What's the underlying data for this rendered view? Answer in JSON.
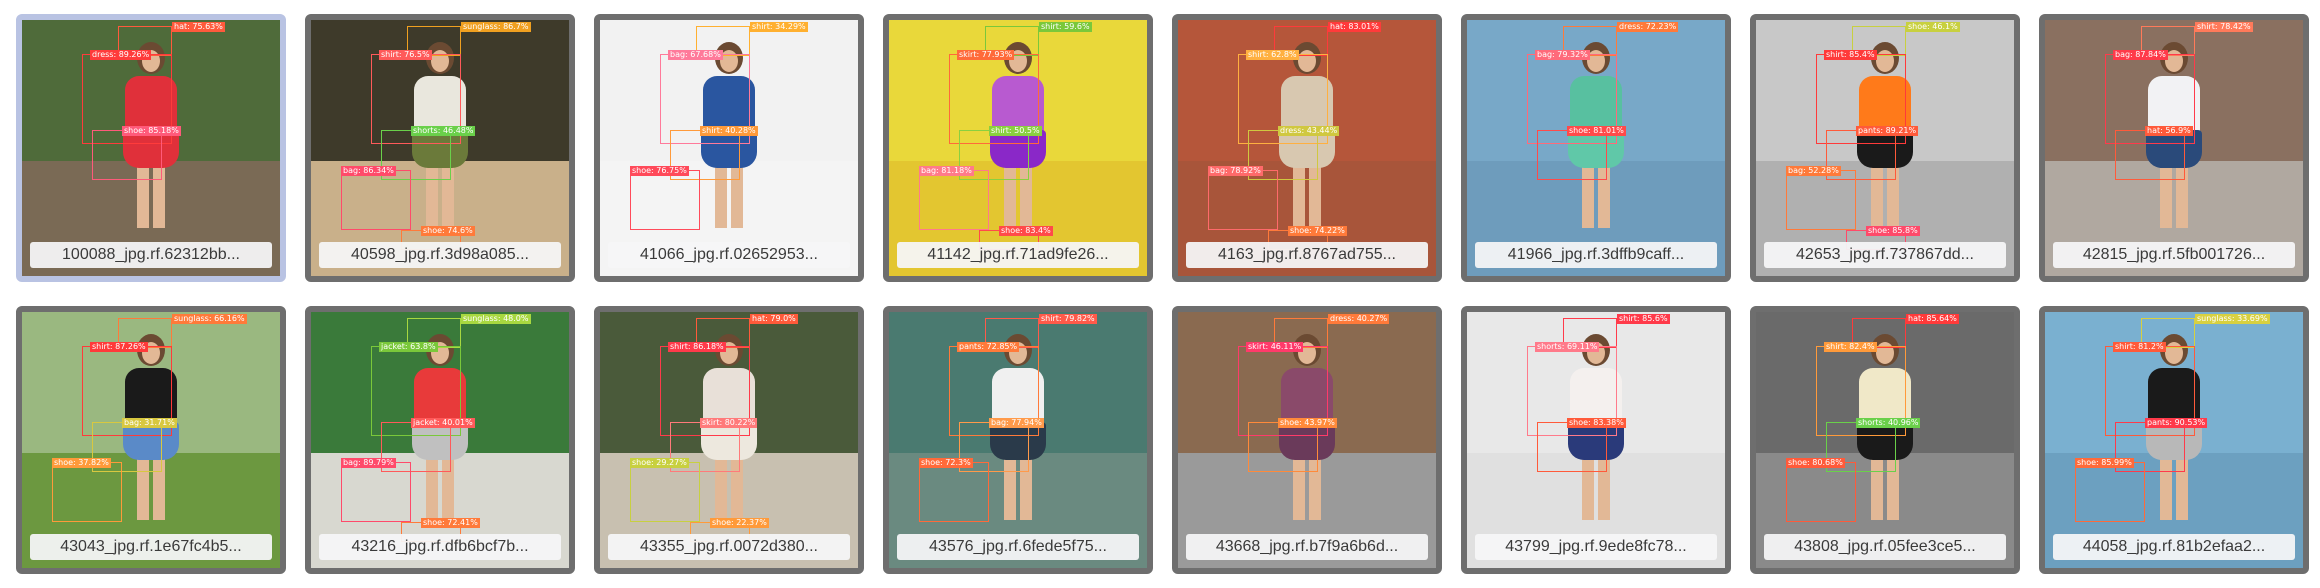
{
  "gallery": {
    "items": [
      {
        "filename": "100088_jpg.rf.62312bb...",
        "selected": true,
        "bg": [
          "#4f6b3a",
          "#7a6a55"
        ],
        "top": "#e0303a",
        "bottom": "#e0303a",
        "labels": [
          {
            "text": "hat: 75.63%",
            "color": "#ff5a3c"
          },
          {
            "text": "dress: 89.26%",
            "color": "#ff3b3b"
          },
          {
            "text": "shoe: 85.18%",
            "color": "#ff5a7a"
          }
        ]
      },
      {
        "filename": "40598_jpg.rf.3d98a085...",
        "selected": false,
        "bg": [
          "#3e3a2a",
          "#c9b08a"
        ],
        "top": "#e9e7dd",
        "bottom": "#6b7a3a",
        "labels": [
          {
            "text": "sunglass: 86.7%",
            "color": "#f0a020"
          },
          {
            "text": "shirt: 76.5%",
            "color": "#ff5a5a"
          },
          {
            "text": "shorts: 46.48%",
            "color": "#6ad04a"
          },
          {
            "text": "bag: 86.34%",
            "color": "#ff4a6a"
          },
          {
            "text": "shoe: 74.6%",
            "color": "#ff7a3a"
          }
        ]
      },
      {
        "filename": "41066_jpg.rf.02652953...",
        "selected": false,
        "bg": [
          "#f2f2f2",
          "#f4f4f4"
        ],
        "top": "#2a56a0",
        "bottom": "#2a56a0",
        "labels": [
          {
            "text": "shirt: 34.29%",
            "color": "#ffb030"
          },
          {
            "text": "bag: 67.68%",
            "color": "#ff7a9a"
          },
          {
            "text": "shirt: 40.28%",
            "color": "#ff9a3a"
          },
          {
            "text": "shoe: 76.75%",
            "color": "#ff4a5a"
          }
        ]
      },
      {
        "filename": "41142_jpg.rf.71ad9fe26...",
        "selected": false,
        "bg": [
          "#e9d83a",
          "#e3c630"
        ],
        "top": "#b85ad0",
        "bottom": "#8a28c8",
        "labels": [
          {
            "text": "shirt: 59.6%",
            "color": "#7ac83a"
          },
          {
            "text": "skirt: 77.93%",
            "color": "#ff6a3a"
          },
          {
            "text": "shirt: 50.5%",
            "color": "#8ad040"
          },
          {
            "text": "bag: 81.18%",
            "color": "#ff7a8a"
          },
          {
            "text": "shoe: 83.4%",
            "color": "#ff4a4a"
          }
        ]
      },
      {
        "filename": "4163_jpg.rf.8767ad755...",
        "selected": false,
        "bg": [
          "#b5563a",
          "#a8553a"
        ],
        "top": "#d8c8b0",
        "bottom": "#d8c8b0",
        "labels": [
          {
            "text": "hat: 83.01%",
            "color": "#ff3a3a"
          },
          {
            "text": "shirt: 62.8%",
            "color": "#ffb040"
          },
          {
            "text": "dress: 43.44%",
            "color": "#d0c840"
          },
          {
            "text": "bag: 78.92%",
            "color": "#ff6a6a"
          },
          {
            "text": "shoe: 74.22%",
            "color": "#ff7a3a"
          }
        ]
      },
      {
        "filename": "41966_jpg.rf.3dffb9caff...",
        "selected": false,
        "bg": [
          "#78a8c8",
          "#6e9cbc"
        ],
        "top": "#58c0a0",
        "bottom": "#60c8a8",
        "labels": [
          {
            "text": "dress: 72.23%",
            "color": "#ff7a3a"
          },
          {
            "text": "bag: 79.32%",
            "color": "#ff6a7a"
          },
          {
            "text": "shoe: 81.01%",
            "color": "#ff4a4a"
          }
        ]
      },
      {
        "filename": "42653_jpg.rf.737867dd...",
        "selected": false,
        "bg": [
          "#c8c8c8",
          "#b0b0b0"
        ],
        "top": "#ff7a1a",
        "bottom": "#1a1a1a",
        "labels": [
          {
            "text": "shoe: 46.1%",
            "color": "#c8d040"
          },
          {
            "text": "shirt: 85.4%",
            "color": "#ff3a3a"
          },
          {
            "text": "pants: 89.21%",
            "color": "#ff5a3a"
          },
          {
            "text": "bag: 52.28%",
            "color": "#ff7a3a"
          },
          {
            "text": "shoe: 85.8%",
            "color": "#ff4a6a"
          }
        ]
      },
      {
        "filename": "42815_jpg.rf.5fb001726...",
        "selected": false,
        "bg": [
          "#8a7060",
          "#b0a8a0"
        ],
        "top": "#f2f2f4",
        "bottom": "#2a4a7a",
        "labels": [
          {
            "text": "shirt: 78.42%",
            "color": "#ff7a5a"
          },
          {
            "text": "bag: 87.84%",
            "color": "#ff3a4a"
          },
          {
            "text": "hat: 56.9%",
            "color": "#ff5a3a"
          }
        ]
      },
      {
        "filename": "43043_jpg.rf.1e67fc4b5...",
        "selected": false,
        "bg": [
          "#9ab880",
          "#6c9840"
        ],
        "top": "#1a1a1a",
        "bottom": "#5a8ac8",
        "labels": [
          {
            "text": "sunglass: 66.16%",
            "color": "#ff7a3a"
          },
          {
            "text": "shirt: 87.26%",
            "color": "#ff3a3a"
          },
          {
            "text": "bag: 31.71%",
            "color": "#d8c840"
          },
          {
            "text": "shoe: 37.82%",
            "color": "#ff9a3a"
          }
        ]
      },
      {
        "filename": "43216_jpg.rf.dfb6bcf7b...",
        "selected": false,
        "bg": [
          "#3a7a3a",
          "#d8d8d0"
        ],
        "top": "#e83a3a",
        "bottom": "#c0c0c0",
        "labels": [
          {
            "text": "sunglass: 48.0%",
            "color": "#a8d840"
          },
          {
            "text": "jacket: 63.8%",
            "color": "#7ac83a"
          },
          {
            "text": "jacket: 40.01%",
            "color": "#ff5a5a"
          },
          {
            "text": "bag: 89.79%",
            "color": "#ff4a6a"
          },
          {
            "text": "shoe: 72.41%",
            "color": "#ff7a3a"
          }
        ]
      },
      {
        "filename": "43355_jpg.rf.0072d380...",
        "selected": false,
        "bg": [
          "#4a5a3a",
          "#c8c0b0"
        ],
        "top": "#e8e0d8",
        "bottom": "#ede8de",
        "labels": [
          {
            "text": "hat: 79.0%",
            "color": "#ff5a3a"
          },
          {
            "text": "shirt: 86.18%",
            "color": "#ff3a4a"
          },
          {
            "text": "skirt: 80.22%",
            "color": "#ff7a7a"
          },
          {
            "text": "shoe: 29.27%",
            "color": "#c8d040"
          },
          {
            "text": "shoe: 22.37%",
            "color": "#ff9a3a"
          }
        ]
      },
      {
        "filename": "43576_jpg.rf.6fede5f75...",
        "selected": false,
        "bg": [
          "#4a7a70",
          "#6a8a80"
        ],
        "top": "#f0f0f0",
        "bottom": "#2a3a4a",
        "labels": [
          {
            "text": "shirt: 79.82%",
            "color": "#ff5a4a"
          },
          {
            "text": "pants: 72.85%",
            "color": "#ff7a3a"
          },
          {
            "text": "bag: 77.94%",
            "color": "#ff9a4a"
          },
          {
            "text": "shoe: 72.3%",
            "color": "#ff6a3a"
          }
        ]
      },
      {
        "filename": "43668_jpg.rf.b7f9a6b6d...",
        "selected": false,
        "bg": [
          "#8a6a50",
          "#9a9a9a"
        ],
        "top": "#8a4a6a",
        "bottom": "#6a3a5a",
        "labels": [
          {
            "text": "dress: 40.27%",
            "color": "#ff7a3a"
          },
          {
            "text": "skirt: 46.11%",
            "color": "#ff3a6a"
          },
          {
            "text": "shoe: 43.97%",
            "color": "#ff8a3a"
          }
        ]
      },
      {
        "filename": "43799_jpg.rf.9ede8fc78...",
        "selected": false,
        "bg": [
          "#e8e8e8",
          "#e0e0e0"
        ],
        "top": "#f4f0ee",
        "bottom": "#2a3a7a",
        "labels": [
          {
            "text": "shirt: 85.6%",
            "color": "#ff3a4a"
          },
          {
            "text": "shorts: 69.11%",
            "color": "#ff7a8a"
          },
          {
            "text": "shoe: 83.38%",
            "color": "#ff5a3a"
          }
        ]
      },
      {
        "filename": "43808_jpg.rf.05fee3ce5...",
        "selected": false,
        "bg": [
          "#6a6a6a",
          "#8a8a8a"
        ],
        "top": "#f0e8c8",
        "bottom": "#1a1a1a",
        "labels": [
          {
            "text": "hat: 85.64%",
            "color": "#ff3a3a"
          },
          {
            "text": "shirt: 82.4%",
            "color": "#ff9a3a"
          },
          {
            "text": "shorts: 40.96%",
            "color": "#6ad04a"
          },
          {
            "text": "shoe: 80.68%",
            "color": "#ff5a3a"
          }
        ]
      },
      {
        "filename": "44058_jpg.rf.81b2efaa2...",
        "selected": false,
        "bg": [
          "#7ab0d0",
          "#6ca0c0"
        ],
        "top": "#1a1a1a",
        "bottom": "#b8b8b8",
        "labels": [
          {
            "text": "sunglass: 33.69%",
            "color": "#d8d040"
          },
          {
            "text": "shirt: 81.2%",
            "color": "#ff5a3a"
          },
          {
            "text": "pants: 90.53%",
            "color": "#ff3a4a"
          },
          {
            "text": "shoe: 85.99%",
            "color": "#ff6a3a"
          }
        ]
      }
    ]
  }
}
